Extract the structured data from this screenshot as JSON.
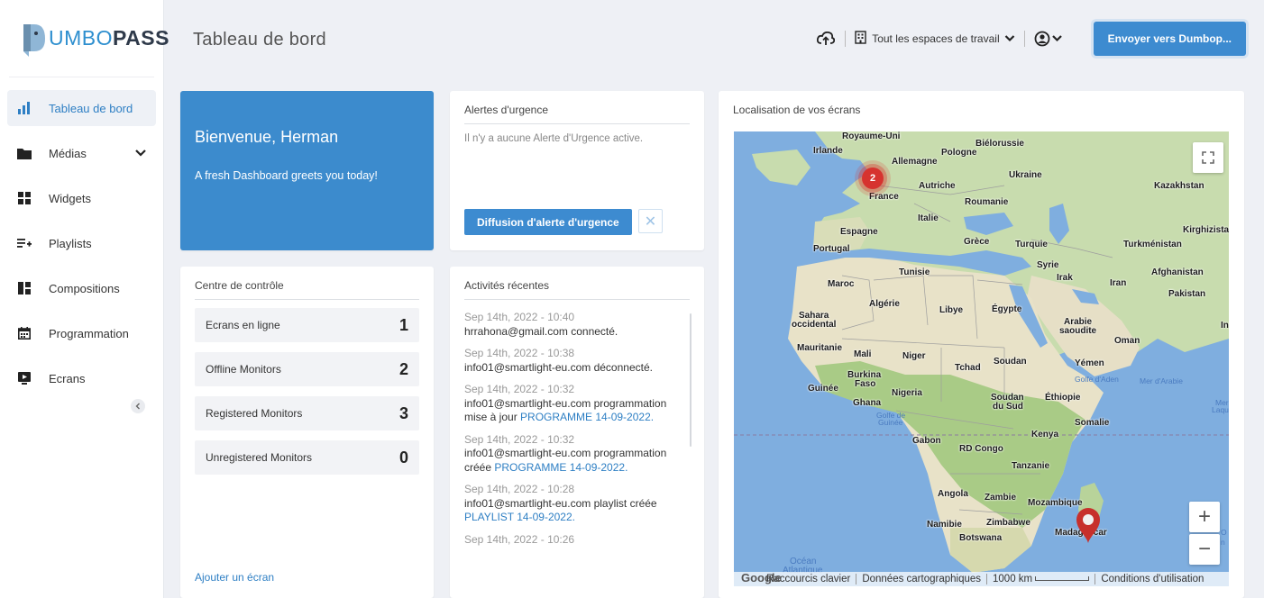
{
  "brand": {
    "logo_part1": "UMBO",
    "logo_part2": "PASS",
    "logo_icon": "dumbo-elephant-icon"
  },
  "header": {
    "title": "Tableau de bord",
    "workspace_label": "Tout les espaces de travail",
    "send_button": "Envoyer vers Dumbop..."
  },
  "sidebar": {
    "items": [
      {
        "label": "Tableau de bord",
        "icon": "bar-chart-icon",
        "active": true
      },
      {
        "label": "Médias",
        "icon": "folder-icon"
      },
      {
        "label": "Widgets",
        "icon": "widgets-icon"
      },
      {
        "label": "Playlists",
        "icon": "playlist-add-icon"
      },
      {
        "label": "Compositions",
        "icon": "layout-icon"
      },
      {
        "label": "Programmation",
        "icon": "calendar-icon"
      },
      {
        "label": "Ecrans",
        "icon": "monitor-play-icon"
      }
    ]
  },
  "welcome": {
    "title": "Bienvenue, Herman",
    "subtitle": "A fresh Dashboard greets you today!"
  },
  "alerts": {
    "title": "Alertes d'urgence",
    "empty": "Il n'y a aucune Alerte d'Urgence active.",
    "broadcast_button": "Diffusion d'alerte d'urgence",
    "close_symbol": "✕"
  },
  "control": {
    "title": "Centre de contrôle",
    "rows": [
      {
        "label": "Ecrans en ligne",
        "count": "1"
      },
      {
        "label": "Offline Monitors",
        "count": "2"
      },
      {
        "label": "Registered Monitors",
        "count": "3"
      },
      {
        "label": "Unregistered Monitors",
        "count": "0"
      }
    ],
    "add_link": "Ajouter un écran"
  },
  "activity": {
    "title": "Activités récentes",
    "items": [
      {
        "time": "Sep 14th, 2022 - 10:40",
        "text": "hrrahona@gmail.com connecté.",
        "link": ""
      },
      {
        "time": "Sep 14th, 2022 - 10:38",
        "text": "info01@smartlight-eu.com déconnecté.",
        "link": ""
      },
      {
        "time": "Sep 14th, 2022 - 10:32",
        "text": "info01@smartlight-eu.com programmation mise à jour ",
        "link": "PROGRAMME 14-09-2022."
      },
      {
        "time": "Sep 14th, 2022 - 10:32",
        "text": "info01@smartlight-eu.com programmation créée ",
        "link": "PROGRAMME 14-09-2022."
      },
      {
        "time": "Sep 14th, 2022 - 10:28",
        "text": "info01@smartlight-eu.com playlist créée ",
        "link": "PLAYLIST 14-09-2022."
      },
      {
        "time": "Sep 14th, 2022 - 10:26",
        "text": "",
        "link": ""
      }
    ]
  },
  "map": {
    "title": "Localisation de vos écrans",
    "cluster_count": "2",
    "zoom_in": "+",
    "zoom_out": "−",
    "footer": {
      "shortcuts": "Raccourcis clavier",
      "data": "Données cartographiques",
      "scale": "1000 km",
      "terms": "Conditions d'utilisation"
    },
    "google": "Google",
    "labels": {
      "uk": "Royaume-Uni",
      "ireland": "Irlande",
      "belarus": "Biélorussie",
      "poland": "Pologne",
      "germany": "Allemagne",
      "ukraine": "Ukraine",
      "kazakhstan": "Kazakhstan",
      "france": "France",
      "austria": "Autriche",
      "romania": "Roumanie",
      "italy": "Italie",
      "spain": "Espagne",
      "greece": "Grèce",
      "turkey": "Turquie",
      "turkmenistan": "Turkménistan",
      "kyrgyz": "Kirghizista",
      "portugal": "Portugal",
      "syria": "Syrie",
      "tunisia": "Tunisie",
      "iraq": "Irak",
      "iran": "Iran",
      "afghanistan": "Afghanistan",
      "pakistan": "Pakistan",
      "morocco": "Maroc",
      "algeria": "Algérie",
      "libya": "Libye",
      "egypt": "Égypte",
      "wsahara1": "Sahara",
      "wsahara2": "occidental",
      "saudi1": "Arabie",
      "saudi2": "saoudite",
      "oman": "Oman",
      "mauritania": "Mauritanie",
      "mali": "Mali",
      "niger": "Niger",
      "chad": "Tchad",
      "sudan": "Soudan",
      "yemen": "Yémen",
      "gulf_aden": "Golfe d'Aden",
      "arabian_sea": "Mer d'Arabie",
      "burkina1": "Burkina",
      "burkina2": "Faso",
      "guinea": "Guinée",
      "nigeria": "Nigeria",
      "ghana": "Ghana",
      "ssudan1": "Soudan",
      "ssudan2": "du Sud",
      "ethiopia": "Éthiopie",
      "gulf_guinea1": "Golfe de",
      "gulf_guinea2": "Guinée",
      "somalia": "Somalie",
      "kenya": "Kenya",
      "gabon": "Gabon",
      "drc": "RD Congo",
      "tanzania": "Tanzanie",
      "angola": "Angola",
      "zambia": "Zambie",
      "mozambique": "Mozambique",
      "namibia": "Namibie",
      "zimbabwe": "Zimbabwe",
      "botswana": "Botswana",
      "madagascar": "Madagascar",
      "ocean1": "Océan",
      "ocean2": "Atlantique",
      "mer1": "Mer",
      "mer2": "Laque",
      "o": "O",
      "n": "n",
      "in": "In"
    }
  }
}
